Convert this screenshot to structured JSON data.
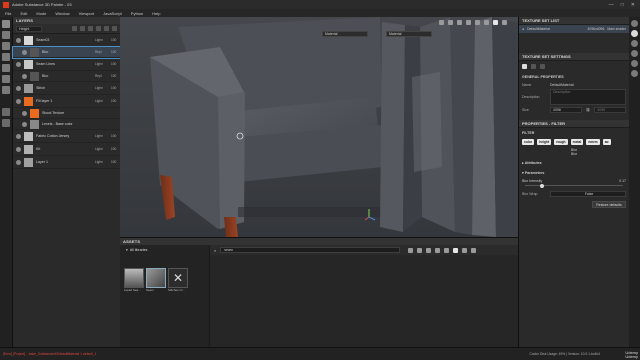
{
  "app": {
    "title": "Adobe Substance 3D Painter - 03"
  },
  "menu": [
    "File",
    "Edit",
    "Mode",
    "Window",
    "Viewport",
    "JavaScript",
    "Python",
    "Help"
  ],
  "layers": {
    "header": "LAYERS",
    "channel": "Height",
    "rows": [
      {
        "name": "Seam03",
        "blend": "Lighn",
        "opacity": "100",
        "thumb": "#d8d8d8",
        "level": 0,
        "selected": false
      },
      {
        "name": "Blur",
        "blend": "Repl",
        "opacity": "100",
        "thumb": "#555",
        "level": 1,
        "selected": true
      },
      {
        "name": "Seam Lines",
        "blend": "Lighn",
        "opacity": "100",
        "thumb": "#c8c8c8",
        "level": 0,
        "selected": false
      },
      {
        "name": "Blur",
        "blend": "Repl",
        "opacity": "100",
        "thumb": "#555",
        "level": 1,
        "selected": false
      },
      {
        "name": "Stitch",
        "blend": "Lighn",
        "opacity": "100",
        "thumb": "#999",
        "level": 0,
        "selected": false
      },
      {
        "name": "Fill layer 1",
        "blend": "Lighn",
        "opacity": "100",
        "thumb": "#e86b1f",
        "level": 0,
        "selected": false
      },
      {
        "name": "Stood Texture",
        "blend": "",
        "opacity": "",
        "thumb": "#e86b1f",
        "level": 1,
        "selected": false
      },
      {
        "name": "Levels - Base color",
        "blend": "",
        "opacity": "",
        "thumb": "#888",
        "level": 1,
        "selected": false
      },
      {
        "name": "Fabric Cotton Jersey",
        "blend": "Lighn",
        "opacity": "100",
        "thumb": "#bdbdbd",
        "level": 0,
        "selected": false
      },
      {
        "name": "Kit",
        "blend": "Lighn",
        "opacity": "100",
        "thumb": "#b0b0b0",
        "level": 0,
        "selected": false
      },
      {
        "name": "Layer 1",
        "blend": "Lighn",
        "opacity": "100",
        "thumb": "#a0a0a0",
        "level": 0,
        "selected": false
      }
    ]
  },
  "viewport": {
    "material_left": "Material",
    "material_right": "Material"
  },
  "assets": {
    "header": "ASSETS",
    "library": "All libraries",
    "search": "seam",
    "items": [
      {
        "caption": "Liquid Sea..."
      },
      {
        "caption": "Seam"
      },
      {
        "caption": "Stitches Cr..."
      }
    ]
  },
  "texture_set_list": {
    "header": "TEXTURE SET LIST",
    "item_name": "DefaultMaterial",
    "item_res": "4096x4096",
    "item_shader": "Main shader"
  },
  "texture_set_settings": {
    "header": "TEXTURE SET SETTINGS",
    "section": "GENERAL PROPERTIES",
    "name_label": "Name",
    "name_value": "DefaultMaterial",
    "desc_label": "Description",
    "desc_placeholder": "Description",
    "size_label": "Size",
    "size_value": "4096",
    "size_value2": "4096"
  },
  "properties": {
    "header": "PROPERTIES - FILTER",
    "filter_label": "FILTER",
    "chips": [
      "color",
      "height",
      "rough",
      "metal",
      "nmrm",
      "ao"
    ],
    "filter_name": "Blur",
    "filter_type": "Blur",
    "attributes": "Attributes",
    "parameters": "Parameters",
    "blur_intensity_label": "Blur Intensity",
    "blur_intensity_value": "0.17",
    "blur_intensity_fraction": 0.17,
    "blur_wrap_label": "Blur Wrap",
    "blur_wrap_value": "False",
    "restore_defaults": "Restore defaults"
  },
  "status": {
    "error": "[Error] [Project] ...bake_Substance/d/DefaultMaterial 1 default_1",
    "right": "Cache Disk Usage: 49% | Version: 10.0.1-bc4b4"
  },
  "watermark": {
    "line1": "Udemy",
    "line2": "Udemy"
  }
}
